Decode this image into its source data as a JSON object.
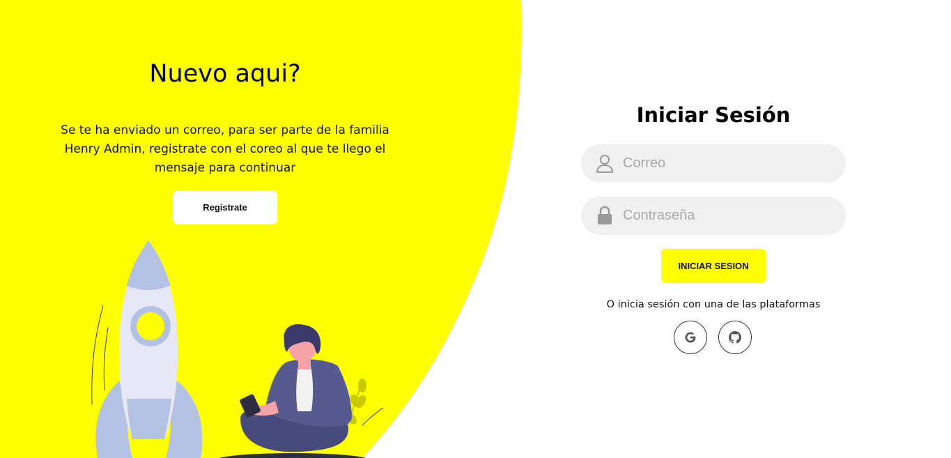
{
  "colors": {
    "accent": "#ffff00",
    "input_bg": "#f0f0f0",
    "placeholder": "#aaaaaa"
  },
  "left_panel": {
    "title": "Nuevo aqui?",
    "description": "Se te ha enviado un correo, para ser parte de la familia Henry Admin, registrate con el coreo al que te llego el mensaje para continuar",
    "register_button": "Registrate",
    "illustration": "rocket-and-person-illustration"
  },
  "login_form": {
    "title": "Iniciar Sesión",
    "email": {
      "placeholder": "Correo",
      "value": "",
      "icon": "user-icon"
    },
    "password": {
      "placeholder": "Contraseña",
      "value": "",
      "icon": "lock-icon"
    },
    "submit_button": "INICIAR SESION",
    "social_text": "O inicia sesión con una de las plataformas",
    "social_buttons": [
      {
        "icon": "google-icon"
      },
      {
        "icon": "github-icon"
      }
    ]
  }
}
